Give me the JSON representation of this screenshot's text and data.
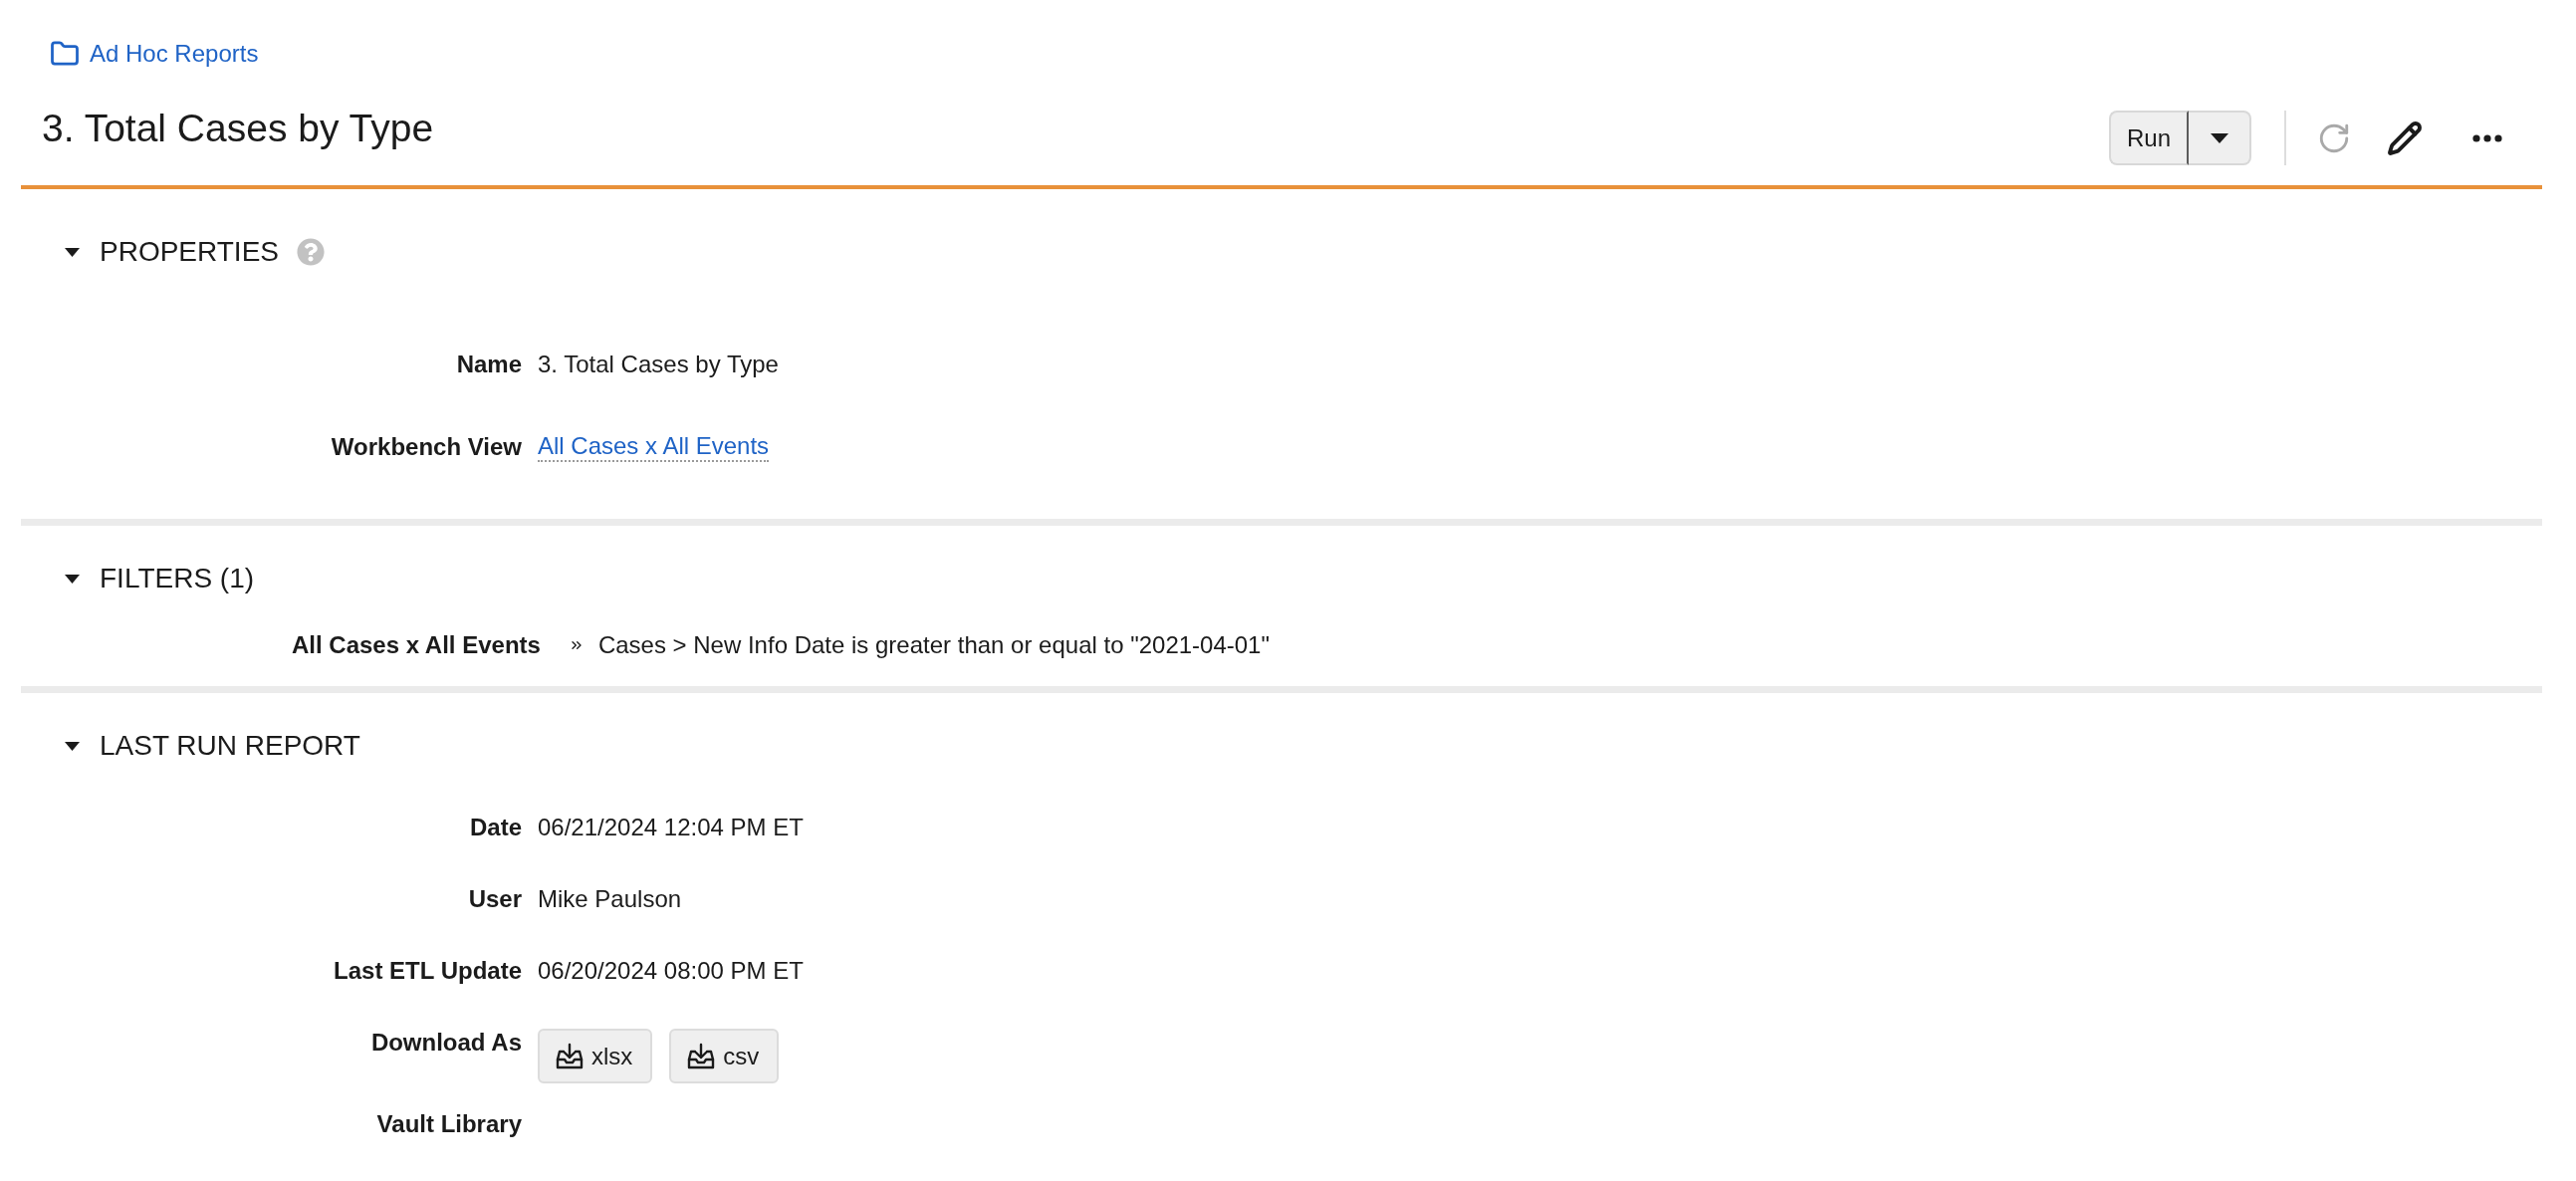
{
  "breadcrumb": {
    "label": "Ad Hoc Reports"
  },
  "title": "3. Total Cases by Type",
  "toolbar": {
    "run": "Run",
    "refresh": {
      "disabled": true
    }
  },
  "sections": [
    {
      "kind": "fields",
      "title": "PROPERTIES",
      "expanded": true,
      "help": true,
      "fields": [
        {
          "label": "Name",
          "kind": "text",
          "value": "3. Total Cases by Type"
        },
        {
          "label": "Workbench View",
          "kind": "link",
          "value": "All Cases x All Events"
        }
      ]
    },
    {
      "kind": "filters",
      "title": "FILTERS (1)",
      "expanded": true,
      "filters": [
        {
          "source": "All Cases x All Events",
          "condition": "Cases > New Info Date is greater than or equal to \"2021-04-01\""
        }
      ]
    },
    {
      "kind": "fields",
      "title": "LAST RUN REPORT",
      "expanded": true,
      "fields": [
        {
          "label": "Date",
          "kind": "text",
          "value": "06/21/2024 12:04 PM ET"
        },
        {
          "label": "User",
          "kind": "text",
          "value": "Mike Paulson"
        },
        {
          "label": "Last ETL Update",
          "kind": "text",
          "value": "06/20/2024 08:00 PM ET"
        },
        {
          "label": "Download As",
          "kind": "downloads",
          "buttons": [
            "xlsx",
            "csv"
          ]
        },
        {
          "label": "Vault Library",
          "kind": "empty"
        }
      ]
    }
  ]
}
